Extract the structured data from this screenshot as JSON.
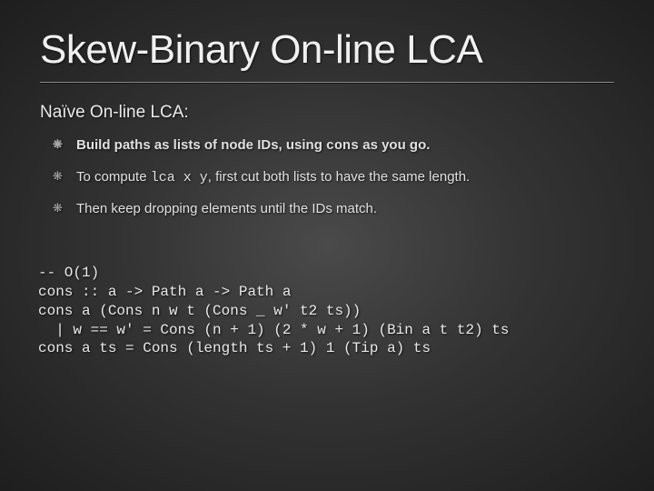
{
  "title": "Skew-Binary On-line LCA",
  "subtitle": "Naïve On-line LCA:",
  "bullets": [
    {
      "bold": true,
      "html": "Build paths as lists of node IDs, using <span class=\"mono\">cons</span> as you go."
    },
    {
      "bold": false,
      "html": "To compute <span class=\"mono\">lca x y</span>, first cut both lists to have the same length."
    },
    {
      "bold": false,
      "html": "Then keep dropping elements until the IDs match."
    }
  ],
  "code": "-- O(1)\ncons :: a -> Path a -> Path a\ncons a (Cons n w t (Cons _ w' t2 ts))\n  | w == w' = Cons (n + 1) (2 * w + 1) (Bin a t t2) ts\ncons a ts = Cons (length ts + 1) 1 (Tip a) ts"
}
